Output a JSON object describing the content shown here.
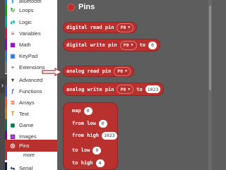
{
  "sidebar": {
    "items": [
      {
        "label": "Bluetooth",
        "icon": "bluetooth-icon",
        "glyph": "ᛒ",
        "color": "#0082fb"
      },
      {
        "label": "Loops",
        "icon": "loops-icon",
        "glyph": "↻",
        "color": "#00aa00"
      },
      {
        "label": "Logic",
        "icon": "logic-icon",
        "glyph": "⇄",
        "color": "#00a4a6"
      },
      {
        "label": "Variables",
        "icon": "variables-icon",
        "glyph": "≡",
        "color": "#dc143c"
      },
      {
        "label": "Math",
        "icon": "math-icon",
        "glyph": "▦",
        "color": "#9400d3"
      },
      {
        "label": "KeyPad",
        "icon": "keypad-icon",
        "glyph": "▣",
        "color": "#2f74ce"
      },
      {
        "label": "Extensions",
        "icon": "extensions-icon",
        "glyph": "+",
        "color": "#777777"
      },
      {
        "label": "Advanced",
        "icon": "advanced-icon",
        "glyph": "▾",
        "color": "#4a4a4a"
      },
      {
        "label": "Functions",
        "icon": "functions-icon",
        "glyph": "ƒ",
        "color": "#3455db"
      },
      {
        "label": "Arrays",
        "icon": "arrays-icon",
        "glyph": "≣",
        "color": "#e65722"
      },
      {
        "label": "Text",
        "icon": "text-icon",
        "glyph": "T",
        "color": "#b8860b"
      },
      {
        "label": "Game",
        "icon": "game-icon",
        "glyph": "◼",
        "color": "#007a4b"
      },
      {
        "label": "Images",
        "icon": "images-icon",
        "glyph": "▨",
        "color": "#7600a8"
      },
      {
        "label": "Pins",
        "icon": "pins-icon",
        "glyph": "◎",
        "color": "#b8312f"
      },
      {
        "label": "more",
        "icon": "more-icon",
        "glyph": "",
        "color": "#b8312f"
      },
      {
        "label": "Serial",
        "icon": "serial-icon",
        "glyph": "⇋",
        "color": "#002050"
      }
    ]
  },
  "category": {
    "title": "Pins",
    "color": "#b8312f"
  },
  "blocks": {
    "digital_read": {
      "text": "digital read pin",
      "pin": "P0"
    },
    "digital_write": {
      "text": "digital write pin",
      "pin": "P0",
      "to": "to",
      "value": "0"
    },
    "analog_read": {
      "text": "analog read pin",
      "pin": "P0"
    },
    "analog_write": {
      "text": "analog write pin",
      "pin": "P0",
      "to": "to",
      "value": "1023"
    },
    "map": {
      "label": "map",
      "value": "0",
      "from_low_label": "from low",
      "from_low": "0",
      "from_high_label": "from high",
      "from_high": "1023",
      "to_low_label": "to low",
      "to_low": "0",
      "to_high_label": "to high",
      "to_high": "4"
    }
  }
}
